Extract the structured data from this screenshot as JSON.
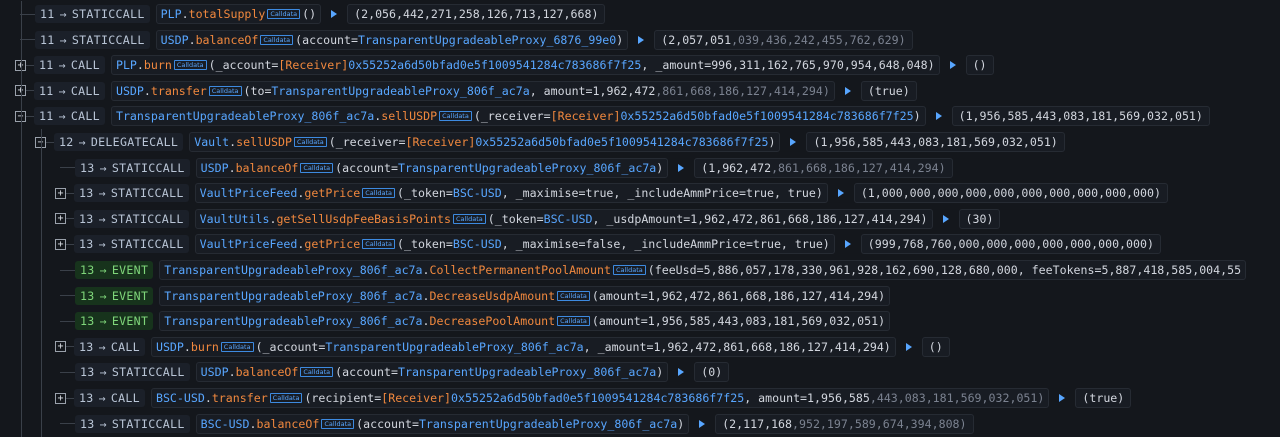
{
  "colors": {
    "background": "#14171c",
    "contract_link": "#58a6ff",
    "receiver_tag": "#f0883e",
    "event_green": "#7fd67a",
    "muted_digits": "#7b8290"
  },
  "badge_label": "Calldata",
  "rows": [
    {
      "depth": "11",
      "type": "STATICCALL",
      "kind": "call",
      "expand": "",
      "contract": "PLP",
      "method": "totalSupply",
      "args": [
        {
          "t": "()",
          "c": "plain"
        }
      ],
      "ret": [
        {
          "t": "(2,056,442,271,258,126,713,127,668)",
          "c": "plain"
        }
      ]
    },
    {
      "depth": "11",
      "type": "STATICCALL",
      "kind": "call",
      "expand": "",
      "contract": "USDP",
      "method": "balanceOf",
      "args": [
        {
          "t": "(account=",
          "c": "plain"
        },
        {
          "t": "TransparentUpgradeableProxy_6876_99e0",
          "c": "blue"
        },
        {
          "t": ")",
          "c": "plain"
        }
      ],
      "ret": [
        {
          "t": "(2,057,051",
          "c": "plain"
        },
        {
          "t": ",039,436,242,455,762,629)",
          "c": "dim"
        }
      ]
    },
    {
      "depth": "11",
      "type": "CALL",
      "kind": "call",
      "expand": "+",
      "contract": "PLP",
      "method": "burn",
      "args": [
        {
          "t": "(_account=",
          "c": "plain"
        },
        {
          "t": "[Receiver]",
          "c": "orange"
        },
        {
          "t": "0x55252a6d50bfad0e5f1009541284c783686f7f25",
          "c": "blue"
        },
        {
          "t": ", _amount=996,311,162,765,970,954,648,048)",
          "c": "plain"
        }
      ],
      "ret": [
        {
          "t": "()",
          "c": "plain"
        }
      ]
    },
    {
      "depth": "11",
      "type": "CALL",
      "kind": "call",
      "expand": "+",
      "contract": "USDP",
      "method": "transfer",
      "args": [
        {
          "t": "(to=",
          "c": "plain"
        },
        {
          "t": "TransparentUpgradeableProxy_806f_ac7a",
          "c": "blue"
        },
        {
          "t": ", amount=1,962,472",
          "c": "plain"
        },
        {
          "t": ",861,668,186,127,414,294)",
          "c": "dim"
        }
      ],
      "ret": [
        {
          "t": "(true)",
          "c": "plain"
        }
      ]
    },
    {
      "depth": "11",
      "type": "CALL",
      "kind": "call",
      "expand": "−",
      "contract": "TransparentUpgradeableProxy_806f_ac7a",
      "method": "sellUSDP",
      "args": [
        {
          "t": "(_receiver=",
          "c": "plain"
        },
        {
          "t": "[Receiver]",
          "c": "orange"
        },
        {
          "t": "0x55252a6d50bfad0e5f1009541284c783686f7f25",
          "c": "blue"
        },
        {
          "t": ")",
          "c": "plain"
        }
      ],
      "ret": [
        {
          "t": "(1,956,585,443,083,181,569,032,051)",
          "c": "plain"
        }
      ]
    },
    {
      "depth": "12",
      "type": "DELEGATECALL",
      "kind": "call",
      "expand": "−",
      "contract": "Vault",
      "method": "sellUSDP",
      "args": [
        {
          "t": "(_receiver=",
          "c": "plain"
        },
        {
          "t": "[Receiver]",
          "c": "orange"
        },
        {
          "t": "0x55252a6d50bfad0e5f1009541284c783686f7f25",
          "c": "blue"
        },
        {
          "t": ")",
          "c": "plain"
        }
      ],
      "ret": [
        {
          "t": "(1,956,585,443,083,181,569,032,051)",
          "c": "plain"
        }
      ]
    },
    {
      "depth": "13",
      "type": "STATICCALL",
      "kind": "call",
      "expand": "",
      "contract": "USDP",
      "method": "balanceOf",
      "args": [
        {
          "t": "(account=",
          "c": "plain"
        },
        {
          "t": "TransparentUpgradeableProxy_806f_ac7a",
          "c": "blue"
        },
        {
          "t": ")",
          "c": "plain"
        }
      ],
      "ret": [
        {
          "t": "(1,962,472",
          "c": "plain"
        },
        {
          "t": ",861,668,186,127,414,294)",
          "c": "dim"
        }
      ]
    },
    {
      "depth": "13",
      "type": "STATICCALL",
      "kind": "call",
      "expand": "+",
      "contract": "VaultPriceFeed",
      "method": "getPrice",
      "args": [
        {
          "t": "(_token=",
          "c": "plain"
        },
        {
          "t": "BSC-USD",
          "c": "blue"
        },
        {
          "t": ", _maximise=true, _includeAmmPrice=true, true)",
          "c": "plain"
        }
      ],
      "ret": [
        {
          "t": "(1,000,000,000,000,000,000,000,000,000,000)",
          "c": "plain"
        }
      ]
    },
    {
      "depth": "13",
      "type": "STATICCALL",
      "kind": "call",
      "expand": "+",
      "contract": "VaultUtils",
      "method": "getSellUsdpFeeBasisPoints",
      "args": [
        {
          "t": "(_token=",
          "c": "plain"
        },
        {
          "t": "BSC-USD",
          "c": "blue"
        },
        {
          "t": ", _usdpAmount=1,962,472,861,668,186,127,414,294)",
          "c": "plain"
        }
      ],
      "ret": [
        {
          "t": "(30)",
          "c": "plain"
        }
      ]
    },
    {
      "depth": "13",
      "type": "STATICCALL",
      "kind": "call",
      "expand": "+",
      "contract": "VaultPriceFeed",
      "method": "getPrice",
      "args": [
        {
          "t": "(_token=",
          "c": "plain"
        },
        {
          "t": "BSC-USD",
          "c": "blue"
        },
        {
          "t": ", _maximise=false, _includeAmmPrice=true, true)",
          "c": "plain"
        }
      ],
      "ret": [
        {
          "t": "(999,768,760,000,000,000,000,000,000,000)",
          "c": "plain"
        }
      ]
    },
    {
      "depth": "13",
      "type": "EVENT",
      "kind": "event",
      "expand": "",
      "contract": "TransparentUpgradeableProxy_806f_ac7a",
      "method": "CollectPermanentPoolAmount",
      "args": [
        {
          "t": "(feeUsd=5,886,057,178,330,961,928,162,690,128,680,000, feeTokens=5,887,418,585,004,55",
          "c": "plain"
        }
      ],
      "ret": []
    },
    {
      "depth": "13",
      "type": "EVENT",
      "kind": "event",
      "expand": "",
      "contract": "TransparentUpgradeableProxy_806f_ac7a",
      "method": "DecreaseUsdpAmount",
      "args": [
        {
          "t": "(amount=1,962,472,861,668,186,127,414,294)",
          "c": "plain"
        }
      ],
      "ret": []
    },
    {
      "depth": "13",
      "type": "EVENT",
      "kind": "event",
      "expand": "",
      "contract": "TransparentUpgradeableProxy_806f_ac7a",
      "method": "DecreasePoolAmount",
      "args": [
        {
          "t": "(amount=1,956,585,443,083,181,569,032,051)",
          "c": "plain"
        }
      ],
      "ret": []
    },
    {
      "depth": "13",
      "type": "CALL",
      "kind": "call",
      "expand": "+",
      "contract": "USDP",
      "method": "burn",
      "args": [
        {
          "t": "(_account=",
          "c": "plain"
        },
        {
          "t": "TransparentUpgradeableProxy_806f_ac7a",
          "c": "blue"
        },
        {
          "t": ", _amount=1,962,472,861,668,186,127,414,294)",
          "c": "plain"
        }
      ],
      "ret": [
        {
          "t": "()",
          "c": "plain"
        }
      ]
    },
    {
      "depth": "13",
      "type": "STATICCALL",
      "kind": "call",
      "expand": "",
      "contract": "USDP",
      "method": "balanceOf",
      "args": [
        {
          "t": "(account=",
          "c": "plain"
        },
        {
          "t": "TransparentUpgradeableProxy_806f_ac7a",
          "c": "blue"
        },
        {
          "t": ")",
          "c": "plain"
        }
      ],
      "ret": [
        {
          "t": "(0)",
          "c": "plain"
        }
      ]
    },
    {
      "depth": "13",
      "type": "CALL",
      "kind": "call",
      "expand": "+",
      "contract": "BSC-USD",
      "method": "transfer",
      "args": [
        {
          "t": "(recipient=",
          "c": "plain"
        },
        {
          "t": "[Receiver]",
          "c": "orange"
        },
        {
          "t": "0x55252a6d50bfad0e5f1009541284c783686f7f25",
          "c": "blue"
        },
        {
          "t": ", amount=1,956,585",
          "c": "plain"
        },
        {
          "t": ",443,083,181,569,032,051)",
          "c": "dim"
        }
      ],
      "ret": [
        {
          "t": "(true)",
          "c": "plain"
        }
      ]
    },
    {
      "depth": "13",
      "type": "STATICCALL",
      "kind": "call",
      "expand": "",
      "contract": "BSC-USD",
      "method": "balanceOf",
      "args": [
        {
          "t": "(account=",
          "c": "plain"
        },
        {
          "t": "TransparentUpgradeableProxy_806f_ac7a",
          "c": "blue"
        },
        {
          "t": ")",
          "c": "plain"
        }
      ],
      "ret": [
        {
          "t": "(2,117,168",
          "c": "plain"
        },
        {
          "t": ",952,197,589,674,394,808)",
          "c": "dim"
        }
      ]
    }
  ]
}
